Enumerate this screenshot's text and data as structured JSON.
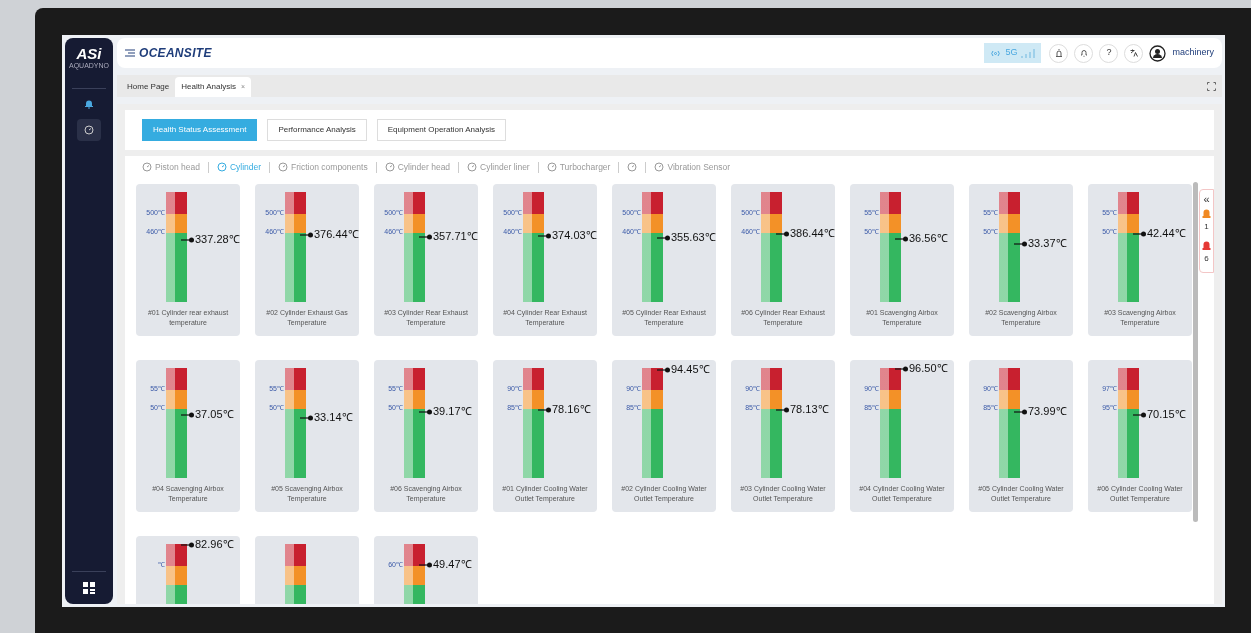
{
  "sidebar": {
    "logo": "ASi",
    "logo_sub": "AQUADYNO"
  },
  "header": {
    "brand": "OCEANSITE",
    "network": "5G",
    "help": "?",
    "user": "machinery"
  },
  "tabs": [
    {
      "label": "Home Page",
      "selected": false
    },
    {
      "label": "Health Analysis",
      "selected": true,
      "close": "×"
    }
  ],
  "views": [
    {
      "label": "Health Status Assessment",
      "selected": true
    },
    {
      "label": "Performance Analysis",
      "selected": false
    },
    {
      "label": "Equipment Operation Analysis",
      "selected": false
    }
  ],
  "filters": [
    {
      "label": "Piston head",
      "selected": false
    },
    {
      "label": "Cylinder",
      "selected": true
    },
    {
      "label": "Friction components",
      "selected": false
    },
    {
      "label": "Cylinder head",
      "selected": false
    },
    {
      "label": "Cylinder liner",
      "selected": false
    },
    {
      "label": "Turbocharger",
      "selected": false
    },
    {
      "selected": false
    },
    {
      "label": "Vibration Sensor",
      "selected": false
    }
  ],
  "gauges": [
    {
      "value": "337.28℃",
      "upper": "500℃",
      "lower": "460℃",
      "level": 0.56,
      "label": "#01 Cylinder rear exhaust temperature"
    },
    {
      "value": "376.44℃",
      "upper": "500℃",
      "lower": "460℃",
      "level": 0.61,
      "label": "#02 Cylinder Exhaust Gas Temperature"
    },
    {
      "value": "357.71℃",
      "upper": "500℃",
      "lower": "460℃",
      "level": 0.59,
      "label": "#03 Cylinder Rear Exhaust Temperature"
    },
    {
      "value": "374.03℃",
      "upper": "500℃",
      "lower": "460℃",
      "level": 0.6,
      "label": "#04 Cylinder Rear Exhaust Temperature"
    },
    {
      "value": "355.63℃",
      "upper": "500℃",
      "lower": "460℃",
      "level": 0.58,
      "label": "#05 Cylinder Rear Exhaust Temperature"
    },
    {
      "value": "386.44℃",
      "upper": "500℃",
      "lower": "460℃",
      "level": 0.62,
      "label": "#06 Cylinder Rear Exhaust Temperature"
    },
    {
      "value": "36.56℃",
      "upper": "55℃",
      "lower": "50℃",
      "level": 0.57,
      "label": "#01 Scavenging Airbox Temperature"
    },
    {
      "value": "33.37℃",
      "upper": "55℃",
      "lower": "50℃",
      "level": 0.53,
      "label": "#02 Scavenging Airbox Temperature"
    },
    {
      "value": "42.44℃",
      "upper": "55℃",
      "lower": "50℃",
      "level": 0.62,
      "label": "#03 Scavenging Airbox Temperature"
    },
    {
      "value": "37.05℃",
      "upper": "55℃",
      "lower": "50℃",
      "level": 0.57,
      "label": "#04 Scavenging Airbox Temperature"
    },
    {
      "value": "33.14℃",
      "upper": "55℃",
      "lower": "50℃",
      "level": 0.55,
      "label": "#05 Scavenging Airbox Temperature"
    },
    {
      "value": "39.17℃",
      "upper": "55℃",
      "lower": "50℃",
      "level": 0.6,
      "label": "#06 Scavenging Airbox Temperature"
    },
    {
      "value": "78.16℃",
      "upper": "90℃",
      "lower": "85℃",
      "level": 0.62,
      "label": "#01 Cylinder Cooling Water Outlet Temperature"
    },
    {
      "value": "94.45℃",
      "upper": "90℃",
      "lower": "85℃",
      "level": 0.98,
      "label": "#02 Cylinder Cooling Water Outlet Temperature"
    },
    {
      "value": "78.13℃",
      "upper": "90℃",
      "lower": "85℃",
      "level": 0.62,
      "label": "#03 Cylinder Cooling Water Outlet Temperature"
    },
    {
      "value": "96.50℃",
      "upper": "90℃",
      "lower": "85℃",
      "level": 0.99,
      "label": "#04 Cylinder Cooling Water Outlet Temperature"
    },
    {
      "value": "73.99℃",
      "upper": "90℃",
      "lower": "85℃",
      "level": 0.6,
      "label": "#05 Cylinder Cooling Water Outlet Temperature"
    },
    {
      "value": "70.15℃",
      "upper": "97℃",
      "lower": "95℃",
      "level": 0.57,
      "label": "#06 Cylinder Cooling Water Outlet Temperature"
    },
    {
      "value": "82.96℃",
      "upper": "℃",
      "level": 0.99
    },
    {
      "marker": false
    },
    {
      "value": "49.47℃",
      "upper": "60℃",
      "level": 0.81
    }
  ],
  "alert_panel": {
    "collapse": "«"
  },
  "alerts": [
    {
      "count": "1",
      "color": "#f08a24"
    },
    {
      "count": "6",
      "color": "#e53935"
    }
  ]
}
